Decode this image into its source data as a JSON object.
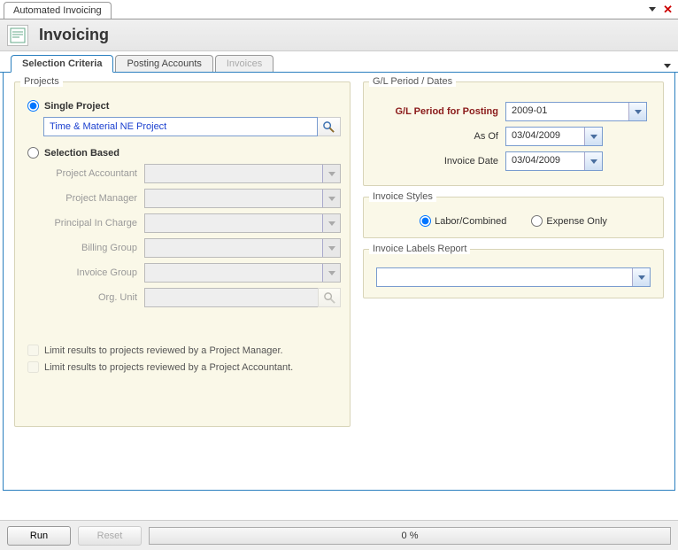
{
  "window": {
    "tab": "Automated Invoicing"
  },
  "header": {
    "title": "Invoicing"
  },
  "tabs": {
    "items": [
      {
        "label": "Selection Criteria"
      },
      {
        "label": "Posting Accounts"
      },
      {
        "label": "Invoices"
      }
    ]
  },
  "projects": {
    "legend": "Projects",
    "single_label": "Single Project",
    "single_value": "Time & Material NE Project",
    "selection_label": "Selection Based",
    "fields": {
      "accountant": "Project Accountant",
      "manager": "Project Manager",
      "principal": "Principal In Charge",
      "billing_group": "Billing Group",
      "invoice_group": "Invoice Group",
      "org_unit": "Org. Unit"
    },
    "check_pm": "Limit results to projects reviewed by a Project Manager.",
    "check_pa": "Limit results to projects reviewed by a Project Accountant."
  },
  "dates": {
    "legend": "G/L Period / Dates",
    "period_label": "G/L Period for Posting",
    "period_value": "2009-01",
    "asof_label": "As Of",
    "asof_value": "03/04/2009",
    "invoice_date_label": "Invoice Date",
    "invoice_date_value": "03/04/2009"
  },
  "styles": {
    "legend": "Invoice Styles",
    "labor": "Labor/Combined",
    "expense": "Expense Only"
  },
  "labels_report": {
    "legend": "Invoice Labels Report",
    "value": ""
  },
  "footer": {
    "run": "Run",
    "reset": "Reset",
    "progress": "0 %"
  }
}
